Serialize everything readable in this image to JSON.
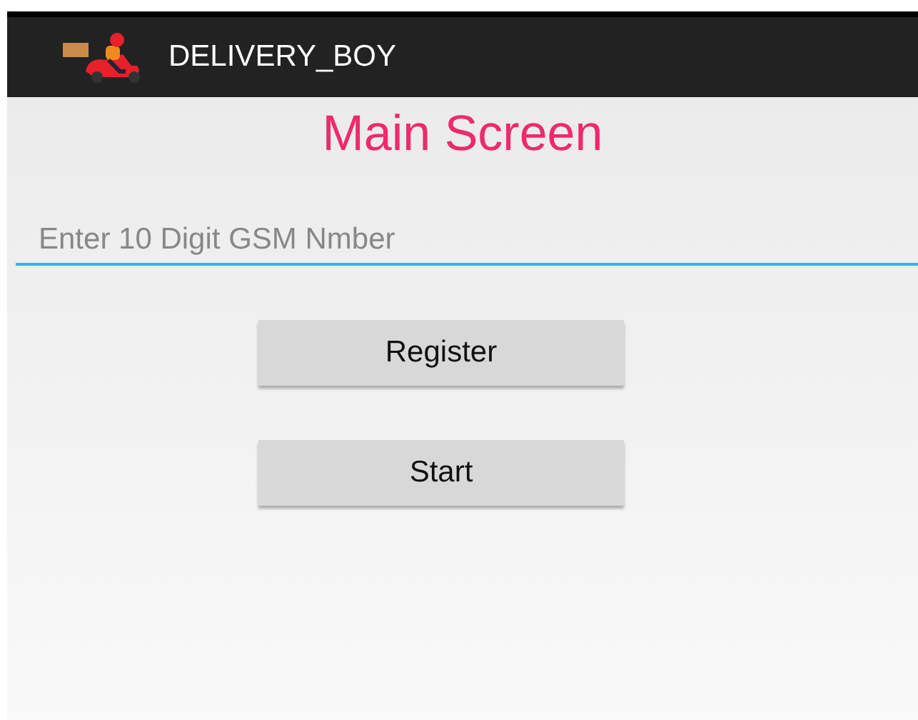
{
  "action_bar": {
    "title": "DELIVERY_BOY"
  },
  "heading": "Main Screen",
  "phone_field": {
    "placeholder": "Enter 10 Digit GSM Nmber"
  },
  "buttons": [
    "Register",
    "Start"
  ]
}
